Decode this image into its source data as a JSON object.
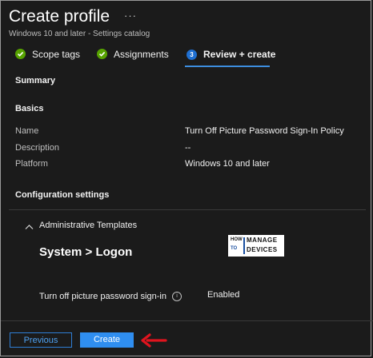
{
  "header": {
    "title": "Create profile",
    "more_label": "···",
    "subtitle": "Windows 10 and later - Settings catalog"
  },
  "tabs": [
    {
      "label": "Scope tags",
      "state": "done"
    },
    {
      "label": "Assignments",
      "state": "done"
    },
    {
      "label": "Review + create",
      "state": "active",
      "step": "3"
    }
  ],
  "summary": {
    "heading": "Summary",
    "basics_heading": "Basics",
    "fields": [
      {
        "key": "Name",
        "value": "Turn Off Picture Password Sign-In Policy"
      },
      {
        "key": "Description",
        "value": "--"
      },
      {
        "key": "Platform",
        "value": "Windows 10 and later"
      }
    ]
  },
  "config": {
    "heading": "Configuration settings",
    "group_label": "Administrative Templates",
    "path": "System > Logon",
    "setting_label": "Turn off picture password sign-in",
    "setting_value": "Enabled"
  },
  "logo": {
    "how": "HOW",
    "to": "TO",
    "manage": "MANAGE",
    "devices": "DEVICES"
  },
  "footer": {
    "previous_label": "Previous",
    "create_label": "Create"
  },
  "colors": {
    "accent": "#2f8ef0",
    "success": "#57a300",
    "arrow": "#e0141e"
  }
}
